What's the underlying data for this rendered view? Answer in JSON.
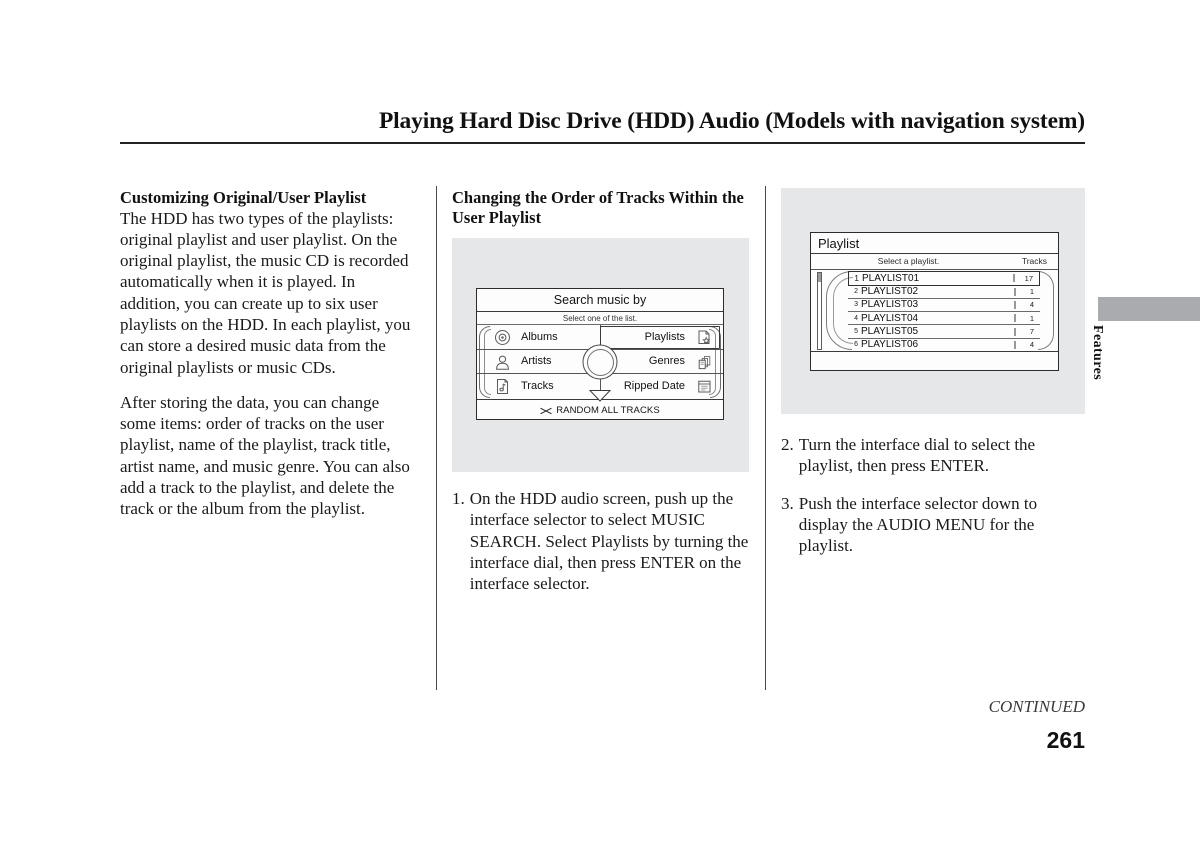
{
  "header": {
    "title": "Playing Hard Disc Drive (HDD) Audio (Models with navigation system)"
  },
  "left_column": {
    "heading": "Customizing Original/User Playlist",
    "paragraph1": "The HDD has two types of the playlists: original playlist and user playlist. On the original playlist, the music CD is recorded automatically when it is played. In addition, you can create up to six user playlists on the HDD. In each playlist, you can store a desired music data from the original playlists or music CDs.",
    "paragraph2": "After storing the data, you can change some items: order of tracks on the user playlist, name of the playlist, track title, artist name, and music genre. You can also add a track to the playlist, and delete the track or the album from the playlist."
  },
  "middle_column": {
    "heading": "Changing the Order of Tracks Within the User Playlist",
    "figure": {
      "title": "Search music by",
      "subtitle": "Select one of the list.",
      "left_items": [
        {
          "label": "Albums",
          "icon": "disc-icon"
        },
        {
          "label": "Artists",
          "icon": "person-icon"
        },
        {
          "label": "Tracks",
          "icon": "music-note-page-icon"
        }
      ],
      "right_items": [
        {
          "label": "Playlists",
          "icon": "page-star-icon",
          "selected": true
        },
        {
          "label": "Genres",
          "icon": "stacked-pages-icon",
          "selected": false
        },
        {
          "label": "Ripped Date",
          "icon": "calendar-page-icon",
          "selected": false
        }
      ],
      "bottom_bar": "RANDOM ALL TRACKS",
      "bottom_bar_icon": "shuffle-icon"
    },
    "steps": [
      {
        "number": "1.",
        "text": "On the HDD audio screen, push up the interface selector to select MUSIC SEARCH. Select Playlists by turning the interface dial, then press ENTER on the interface selector."
      }
    ]
  },
  "right_column": {
    "figure": {
      "title": "Playlist",
      "subtitle": "Select a playlist.",
      "tracks_header": "Tracks",
      "rows": [
        {
          "index": "1",
          "name": "PLAYLIST01",
          "tracks": "17",
          "selected": true
        },
        {
          "index": "2",
          "name": "PLAYLIST02",
          "tracks": "1",
          "selected": false
        },
        {
          "index": "3",
          "name": "PLAYLIST03",
          "tracks": "4",
          "selected": false
        },
        {
          "index": "4",
          "name": "PLAYLIST04",
          "tracks": "1",
          "selected": false
        },
        {
          "index": "5",
          "name": "PLAYLIST05",
          "tracks": "7",
          "selected": false
        },
        {
          "index": "6",
          "name": "PLAYLIST06",
          "tracks": "4",
          "selected": false
        }
      ]
    },
    "steps": [
      {
        "number": "2.",
        "text": "Turn the interface dial to select the playlist, then press ENTER."
      },
      {
        "number": "3.",
        "text": "Push the interface selector down to display the AUDIO MENU for the playlist."
      }
    ]
  },
  "edge": {
    "section_label": "Features",
    "tab_color": "#a9abaf"
  },
  "footer": {
    "continued": "CONTINUED",
    "page_number": "261"
  }
}
